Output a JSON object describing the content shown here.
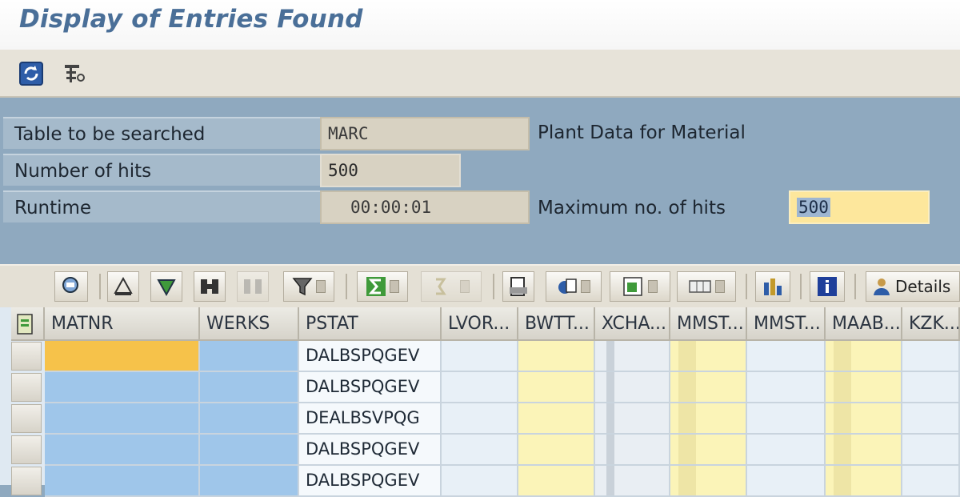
{
  "window": {
    "title": "Display of Entries Found"
  },
  "app_toolbar": {
    "buttons": [
      {
        "icon": "refresh-icon"
      },
      {
        "icon": "selection-criteria-icon"
      }
    ]
  },
  "header": {
    "table_label": "Table to be searched",
    "table_value": "MARC",
    "table_desc": "Plant Data for Material",
    "hits_label": "Number of hits",
    "hits_value": "500",
    "runtime_label": "Runtime",
    "runtime_value": "00:00:01",
    "max_hits_label": "Maximum no. of hits",
    "max_hits_value": "500"
  },
  "alv_toolbar": {
    "details_label": "Details"
  },
  "grid": {
    "columns": [
      "MATNR",
      "WERKS",
      "PSTAT",
      "LVOR...",
      "BWTT...",
      "XCHA...",
      "MMST...",
      "MMST...",
      "MAAB...",
      "KZK..."
    ],
    "rows": [
      {
        "pstat": "DALBSPQGEV"
      },
      {
        "pstat": "DALBSPQGEV"
      },
      {
        "pstat": "DEALBSVPQG"
      },
      {
        "pstat": "DALBSPQGEV"
      },
      {
        "pstat": "DALBSPQGEV"
      }
    ]
  },
  "colors": {
    "title": "#4a6f98",
    "form_bg": "#8fa9bf",
    "editable_field": "#fde79c",
    "selected_cell": "#f6c24a",
    "key_column": "#9fc6ea"
  }
}
